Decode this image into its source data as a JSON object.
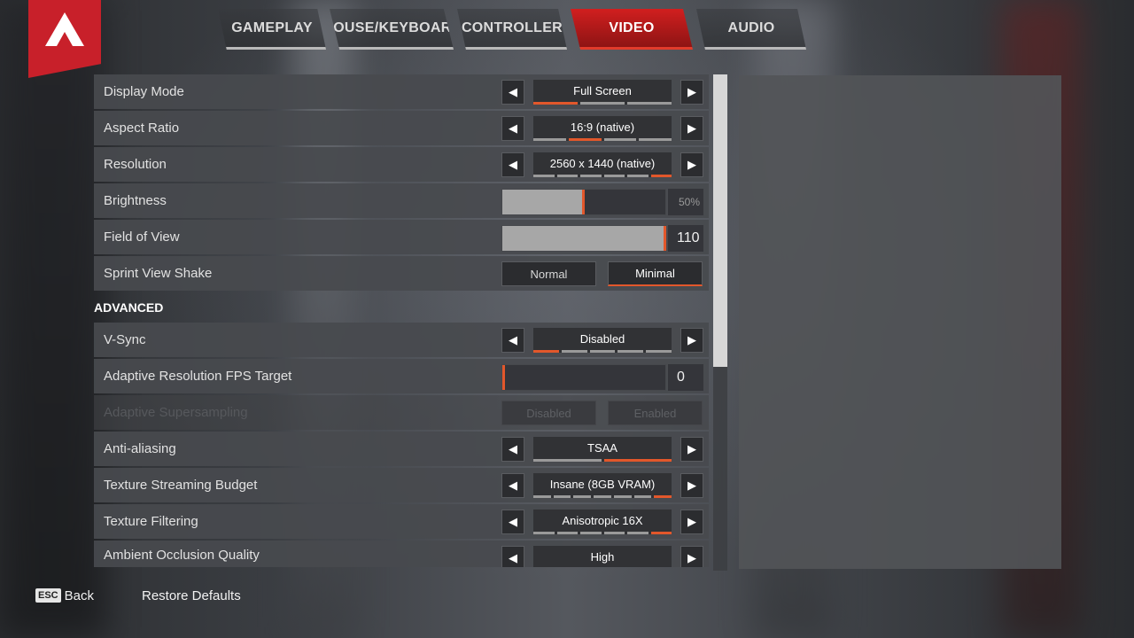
{
  "tabs": [
    {
      "label": "GAMEPLAY",
      "active": false
    },
    {
      "label": "MOUSE/KEYBOARD",
      "active": false
    },
    {
      "label": "CONTROLLER",
      "active": false
    },
    {
      "label": "VIDEO",
      "active": true
    },
    {
      "label": "AUDIO",
      "active": false
    }
  ],
  "settings": {
    "display_mode": {
      "label": "Display Mode",
      "value": "Full Screen",
      "options_count": 3,
      "selected_index": 0
    },
    "aspect_ratio": {
      "label": "Aspect Ratio",
      "value": "16:9 (native)",
      "options_count": 4,
      "selected_index": 1
    },
    "resolution": {
      "label": "Resolution",
      "value": "2560 x 1440 (native)",
      "options_count": 6,
      "selected_index": 5
    },
    "brightness": {
      "label": "Brightness",
      "value": "50%",
      "fraction": 0.5
    },
    "field_of_view": {
      "label": "Field of View",
      "value": "110",
      "fraction": 1.0
    },
    "sprint_view_shake": {
      "label": "Sprint View Shake",
      "options": [
        "Normal",
        "Minimal"
      ],
      "selected": "Minimal"
    }
  },
  "advanced": {
    "title": "ADVANCED",
    "vsync": {
      "label": "V-Sync",
      "value": "Disabled",
      "options_count": 5,
      "selected_index": 0
    },
    "adaptive_fps": {
      "label": "Adaptive Resolution FPS Target",
      "value": "0",
      "fraction": 0.0
    },
    "adaptive_supersampling": {
      "label": "Adaptive Supersampling",
      "options": [
        "Disabled",
        "Enabled"
      ],
      "disabled": true
    },
    "anti_aliasing": {
      "label": "Anti-aliasing",
      "value": "TSAA",
      "options_count": 2,
      "selected_index": 1
    },
    "texture_budget": {
      "label": "Texture Streaming Budget",
      "value": "Insane (8GB VRAM)",
      "options_count": 7,
      "selected_index": 6
    },
    "texture_filtering": {
      "label": "Texture Filtering",
      "value": "Anisotropic 16X",
      "options_count": 6,
      "selected_index": 5
    },
    "ambient_occlusion": {
      "label": "Ambient Occlusion Quality",
      "value": "High"
    }
  },
  "footer": {
    "esc_key": "ESC",
    "back_label": "Back",
    "restore_label": "Restore Defaults"
  },
  "colors": {
    "accent": "#e2572b",
    "active_tab": "#d11f1f",
    "logo": "#c8202a"
  },
  "icons": {
    "logo": "apex-logo-icon",
    "prev": "chevron-left-icon",
    "next": "chevron-right-icon"
  }
}
